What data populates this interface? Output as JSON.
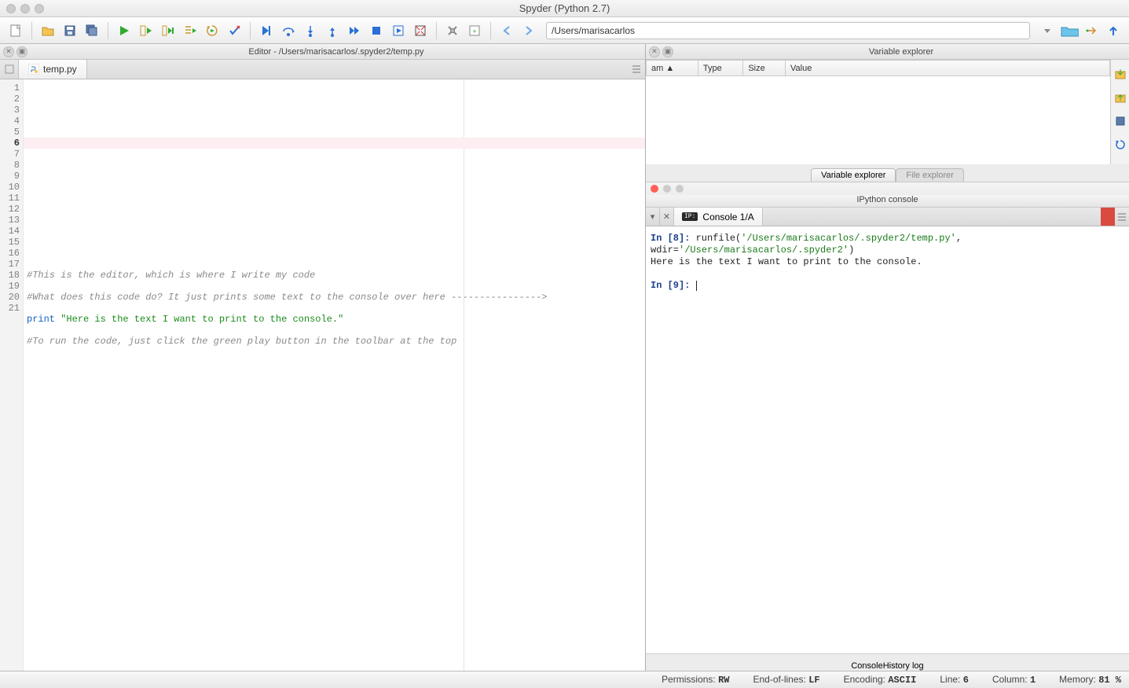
{
  "window": {
    "title": "Spyder (Python 2.7)"
  },
  "toolbar": {
    "path": "/Users/marisacarlos"
  },
  "editor": {
    "pane_title": "Editor - /Users/marisacarlos/.spyder2/temp.py",
    "tab": "temp.py",
    "current_line": 6,
    "lines": [
      {
        "n": 1,
        "text": ""
      },
      {
        "n": 2,
        "text": ""
      },
      {
        "n": 3,
        "text": ""
      },
      {
        "n": 4,
        "text": ""
      },
      {
        "n": 5,
        "text": ""
      },
      {
        "n": 6,
        "text": ""
      },
      {
        "n": 7,
        "text": ""
      },
      {
        "n": 8,
        "text": ""
      },
      {
        "n": 9,
        "text": ""
      },
      {
        "n": 10,
        "text": ""
      },
      {
        "n": 11,
        "text": ""
      },
      {
        "n": 12,
        "text": ""
      },
      {
        "n": 13,
        "text": ""
      },
      {
        "n": 14,
        "text": ""
      },
      {
        "n": 15,
        "type": "comment",
        "text": "#This is the editor, which is where I write my code"
      },
      {
        "n": 16,
        "text": ""
      },
      {
        "n": 17,
        "type": "comment",
        "text": "#What does this code do? It just prints some text to the console over here ---------------->"
      },
      {
        "n": 18,
        "text": ""
      },
      {
        "n": 19,
        "type": "print",
        "kw": "print",
        "str": "\"Here is the text I want to print to the console.\""
      },
      {
        "n": 20,
        "text": ""
      },
      {
        "n": 21,
        "type": "comment",
        "text": "#To run the code, just click the green play button in the toolbar at the top"
      }
    ]
  },
  "variable_explorer": {
    "title": "Variable explorer",
    "columns": [
      "am ▲",
      "Type",
      "Size",
      "Value"
    ],
    "tabs": [
      "Variable explorer",
      "File explorer"
    ]
  },
  "ipython": {
    "title": "IPython console",
    "tab": "Console 1/A",
    "lines": [
      {
        "prompt": "In [8]: ",
        "text": "runfile(",
        "path": "'/Users/marisacarlos/.spyder2/temp.py'",
        "tail": ","
      },
      {
        "cont": "wdir=",
        "path": "'/Users/marisacarlos/.spyder2'",
        "tail": ")"
      },
      {
        "plain": "Here is the text I want to print to the console."
      },
      {
        "blank": true
      },
      {
        "prompt": "In [9]: ",
        "cursor": true
      }
    ],
    "bottom_tabs": [
      "Console",
      "History log"
    ]
  },
  "status": {
    "permissions_label": "Permissions:",
    "permissions": "RW",
    "eol_label": "End-of-lines:",
    "eol": "LF",
    "encoding_label": "Encoding:",
    "encoding": "ASCII",
    "line_label": "Line:",
    "line": "6",
    "column_label": "Column:",
    "column": "1",
    "memory_label": "Memory:",
    "memory": "81 %"
  }
}
